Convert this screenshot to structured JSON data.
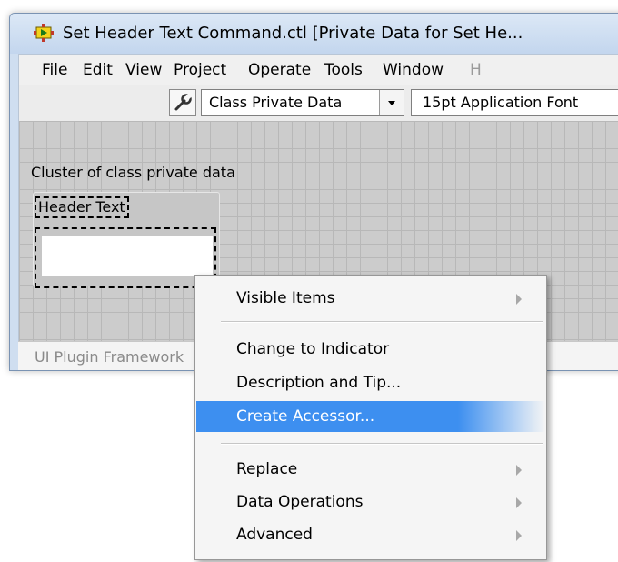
{
  "window": {
    "title": "Set Header Text Command.ctl [Private Data for Set He..."
  },
  "menubar": {
    "items": [
      "File",
      "Edit",
      "View",
      "Project",
      "Operate",
      "Tools",
      "Window",
      "H"
    ]
  },
  "toolbar": {
    "wrench_icon": "wrench-icon",
    "combo_value": "Class Private Data",
    "font_value": "15pt Application Font"
  },
  "canvas": {
    "cluster_label": "Cluster of class private data",
    "header_label": "Header Text",
    "bottom_text": "UI Plugin Framework"
  },
  "context_menu": {
    "visible_items": "Visible Items",
    "change_to_indicator": "Change to Indicator",
    "description_and_tip": "Description and Tip...",
    "create_accessor": "Create Accessor...",
    "replace": "Replace",
    "data_operations": "Data Operations",
    "advanced": "Advanced"
  },
  "colors": {
    "highlight": "#3d8ff0",
    "canvas_bg": "#cccccc"
  }
}
